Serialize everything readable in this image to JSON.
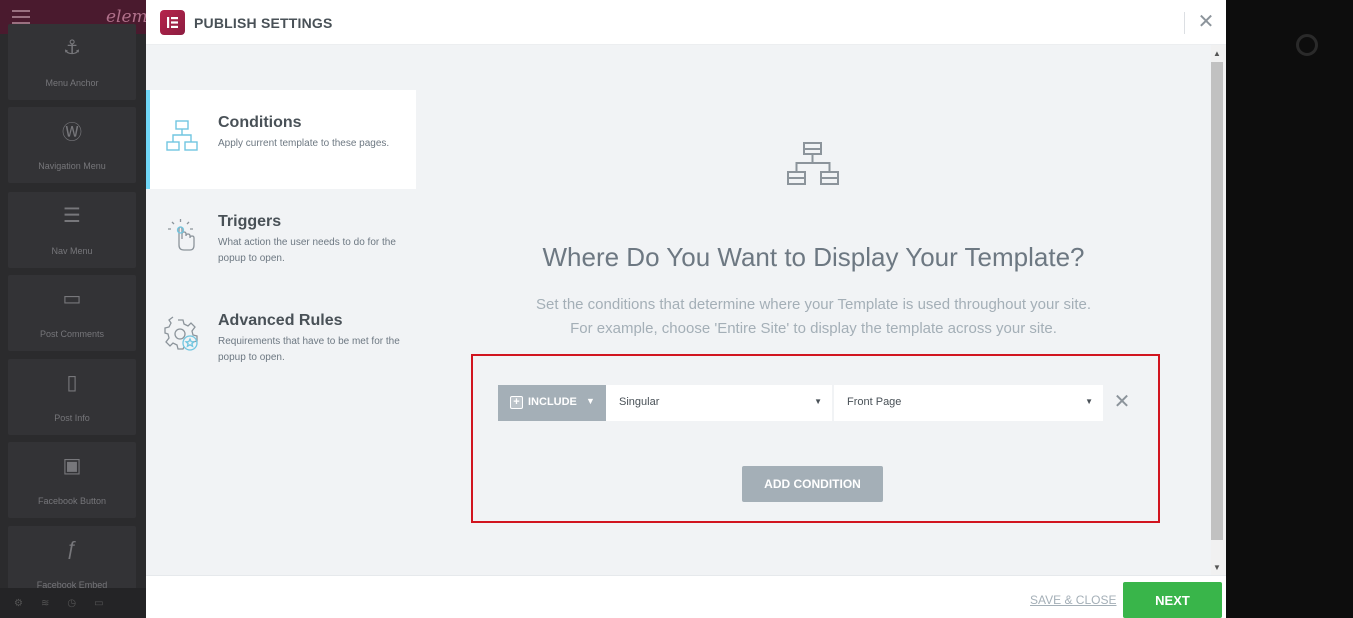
{
  "editor": {
    "brand": "eleme",
    "widgets": [
      {
        "label": "Menu Anchor",
        "icon": "anchor-icon"
      },
      {
        "label": "Navigation Menu",
        "icon": "wordpress-icon"
      },
      {
        "label": "Nav Menu",
        "icon": "nav-menu-icon"
      },
      {
        "label": "Post Comments",
        "icon": "comments-icon"
      },
      {
        "label": "Post Info",
        "icon": "post-info-icon"
      },
      {
        "label": "Facebook Button",
        "icon": "thumbs-up-icon"
      },
      {
        "label": "Facebook Embed",
        "icon": "facebook-embed-icon"
      }
    ]
  },
  "modal": {
    "title": "PUBLISH SETTINGS",
    "close_icon": "close-icon"
  },
  "sidebar": {
    "items": [
      {
        "title": "Conditions",
        "description": "Apply current template to these pages.",
        "icon": "sitemap-icon",
        "active": true
      },
      {
        "title": "Triggers",
        "description": "What action the user needs to do for the popup to open.",
        "icon": "click-hand-icon",
        "active": false
      },
      {
        "title": "Advanced Rules",
        "description": "Requirements that have to be met for the popup to open.",
        "icon": "gear-star-icon",
        "active": false
      }
    ]
  },
  "main": {
    "hero_icon": "sitemap-icon",
    "headline": "Where Do You Want to Display Your Template?",
    "subtext_line1": "Set the conditions that determine where your Template is used throughout your site.",
    "subtext_line2": "For example, choose 'Entire Site' to display the template across your site.",
    "condition": {
      "include_label": "INCLUDE",
      "select1_value": "Singular",
      "select2_value": "Front Page"
    },
    "add_condition_label": "ADD CONDITION"
  },
  "footer": {
    "save_close_label": "SAVE & CLOSE",
    "next_label": "NEXT"
  },
  "colors": {
    "accent_active": "#71d7f7",
    "highlight_border": "#d1141f",
    "next_green": "#39b54a",
    "gray_button": "#a4afb7",
    "brand": "#b6244b"
  }
}
